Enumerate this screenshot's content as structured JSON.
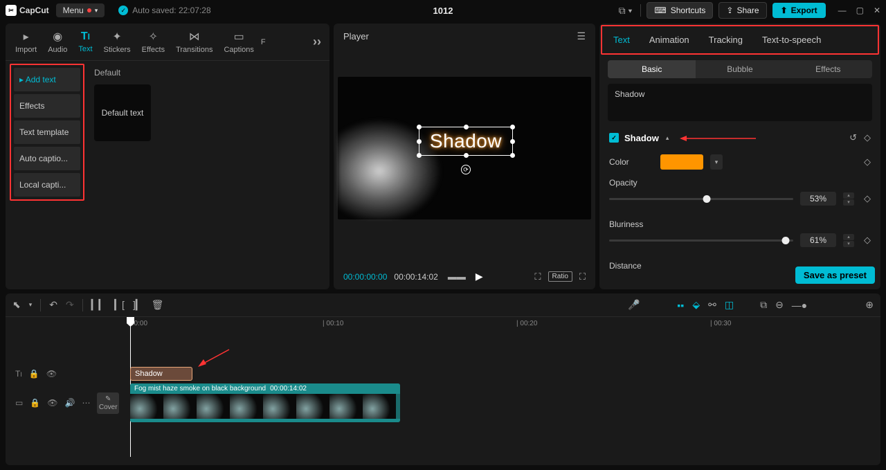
{
  "topbar": {
    "logo_text": "CapCut",
    "menu_label": "Menu",
    "autosave_label": "Auto saved: 22:07:28",
    "title": "1012",
    "shortcuts_label": "Shortcuts",
    "share_label": "Share",
    "export_label": "Export"
  },
  "left_panel": {
    "nav": [
      {
        "label": "Import",
        "icon": "▶"
      },
      {
        "label": "Audio",
        "icon": "◉"
      },
      {
        "label": "Text",
        "icon": "TI",
        "active": true
      },
      {
        "label": "Stickers",
        "icon": "✦"
      },
      {
        "label": "Effects",
        "icon": "✧"
      },
      {
        "label": "Transitions",
        "icon": "⋈"
      },
      {
        "label": "Captions",
        "icon": "▭"
      },
      {
        "label": "F",
        "icon": ""
      }
    ],
    "sidebar": [
      {
        "label": "Add text",
        "active": true
      },
      {
        "label": "Effects"
      },
      {
        "label": "Text template"
      },
      {
        "label": "Auto captio..."
      },
      {
        "label": "Local capti..."
      }
    ],
    "section_label": "Default",
    "default_text_label": "Default text"
  },
  "player": {
    "title": "Player",
    "text_content": "Shadow",
    "current_time": "00:00:00:00",
    "total_time": "00:00:14:02",
    "ratio_label": "Ratio"
  },
  "right_panel": {
    "tabs": [
      {
        "label": "Text",
        "active": true
      },
      {
        "label": "Animation"
      },
      {
        "label": "Tracking"
      },
      {
        "label": "Text-to-speech"
      }
    ],
    "subtabs": [
      {
        "label": "Basic",
        "active": true
      },
      {
        "label": "Bubble"
      },
      {
        "label": "Effects"
      }
    ],
    "textarea_value": "Shadow",
    "section_title": "Shadow",
    "color_label": "Color",
    "color_value": "#ff9500",
    "opacity_label": "Opacity",
    "opacity_value": "53%",
    "opacity_pct": 53,
    "bluriness_label": "Bluriness",
    "bluriness_value": "61%",
    "bluriness_pct": 96,
    "distance_label": "Distance",
    "save_preset_label": "Save as preset"
  },
  "timeline": {
    "ticks": [
      {
        "label": "00:00",
        "pos": 10
      },
      {
        "label": "| 00:10",
        "pos": 288
      },
      {
        "label": "| 00:20",
        "pos": 568
      },
      {
        "label": "| 00:30",
        "pos": 848
      }
    ],
    "cover_label": "Cover",
    "text_clip_label": "Shadow",
    "video_clip_name": "Fog mist haze smoke on black background",
    "video_clip_duration": "00:00:14:02"
  }
}
